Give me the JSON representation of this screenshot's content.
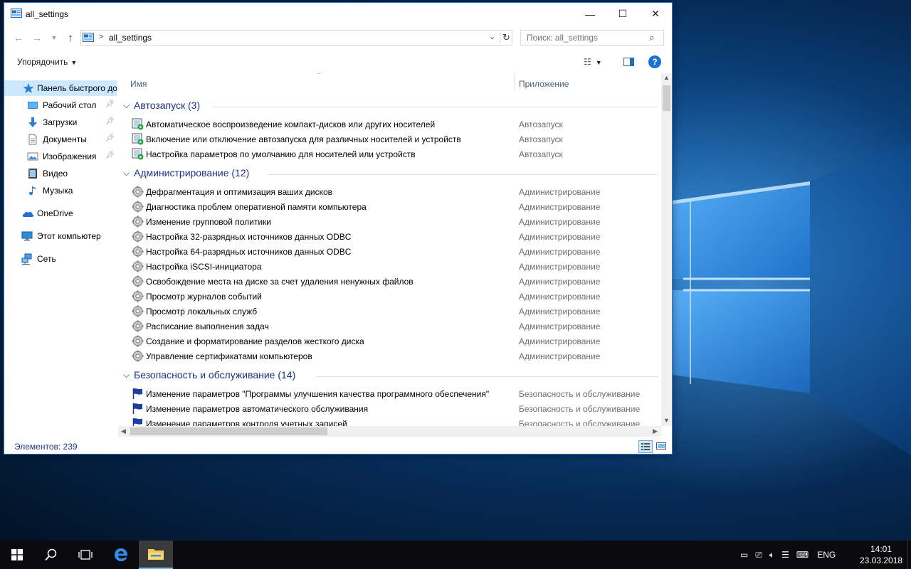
{
  "window": {
    "title": "all_settings",
    "min_glyph": "—",
    "max_glyph": "☐",
    "close_glyph": "✕"
  },
  "address": {
    "separator": ">",
    "path": "all_settings",
    "search_placeholder": "Поиск: all_settings"
  },
  "toolbar": {
    "organize_label": "Упорядочить",
    "help_label": "?"
  },
  "nav": [
    {
      "label": "Панель быстрого доступа",
      "icon": "star-icon",
      "pinned": false,
      "selected": true
    },
    {
      "label": "Рабочий стол",
      "icon": "desktop-folder-icon",
      "pinned": true
    },
    {
      "label": "Загрузки",
      "icon": "downloads-icon",
      "pinned": true
    },
    {
      "label": "Документы",
      "icon": "documents-icon",
      "pinned": true
    },
    {
      "label": "Изображения",
      "icon": "pictures-icon",
      "pinned": true
    },
    {
      "label": "Видео",
      "icon": "videos-icon",
      "pinned": false
    },
    {
      "label": "Музыка",
      "icon": "music-icon",
      "pinned": false
    },
    {
      "label": "OneDrive",
      "icon": "onedrive-icon",
      "pinned": false
    },
    {
      "label": "Этот компьютер",
      "icon": "computer-icon",
      "pinned": false
    },
    {
      "label": "Сеть",
      "icon": "network-icon",
      "pinned": false
    }
  ],
  "columns": {
    "name": "Имя",
    "app": "Приложение"
  },
  "groups": [
    {
      "title": "Автозапуск (3)",
      "icon": "autoplay-icon",
      "items": [
        {
          "name": "Автоматическое воспроизведение компакт-дисков или других носителей",
          "app": "Автозапуск"
        },
        {
          "name": "Включение или отключение автозапуска для различных носителей и устройств",
          "app": "Автозапуск"
        },
        {
          "name": "Настройка параметров по умолчанию для носителей или устройств",
          "app": "Автозапуск"
        }
      ]
    },
    {
      "title": "Администрирование (12)",
      "icon": "admin-tools-icon",
      "items": [
        {
          "name": "Дефрагментация и оптимизация ваших дисков",
          "app": "Администрирование"
        },
        {
          "name": "Диагностика проблем оперативной памяти компьютера",
          "app": "Администрирование"
        },
        {
          "name": "Изменение групповой политики",
          "app": "Администрирование"
        },
        {
          "name": "Настройка 32-разрядных источников данных ODBC",
          "app": "Администрирование"
        },
        {
          "name": "Настройка 64-разрядных источников данных ODBC",
          "app": "Администрирование"
        },
        {
          "name": "Настройка iSCSI-инициатора",
          "app": "Администрирование"
        },
        {
          "name": "Освобождение места на диске за счет удаления ненужных файлов",
          "app": "Администрирование"
        },
        {
          "name": "Просмотр журналов событий",
          "app": "Администрирование"
        },
        {
          "name": "Просмотр локальных служб",
          "app": "Администрирование"
        },
        {
          "name": "Расписание выполнения задач",
          "app": "Администрирование"
        },
        {
          "name": "Создание и форматирование разделов жесткого диска",
          "app": "Администрирование"
        },
        {
          "name": "Управление сертификатами компьютеров",
          "app": "Администрирование"
        }
      ]
    },
    {
      "title": "Безопасность и обслуживание (14)",
      "icon": "security-flag-icon",
      "items": [
        {
          "name": "Изменение параметров \"Программы улучшения качества программного обеспечения\"",
          "app": "Безопасность и обслуживание"
        },
        {
          "name": "Изменение параметров автоматического обслуживания",
          "app": "Безопасность и обслуживание"
        },
        {
          "name": "Изменение параметров контроля учетных записей",
          "app": "Безопасность и обслуживание"
        }
      ]
    }
  ],
  "status": {
    "items_text": "Элементов: 239"
  },
  "taskbar": {
    "language": "ENG",
    "time": "14:01",
    "date": "23.03.2018"
  },
  "colors": {
    "accent": "#1e3287",
    "selection": "#cce8ff",
    "taskbar": "#0b0b0d"
  }
}
